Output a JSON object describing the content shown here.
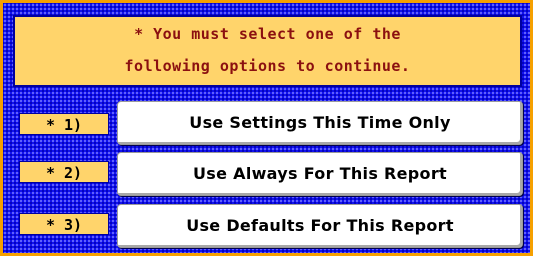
{
  "message": {
    "line1": "* You must select one of the",
    "line2": "following options to continue."
  },
  "options": [
    {
      "number": "* 1)",
      "label": "Use Settings This Time Only"
    },
    {
      "number": "* 2)",
      "label": "Use Always For This Report"
    },
    {
      "number": "* 3)",
      "label": "Use Defaults For This Report"
    }
  ],
  "colors": {
    "border": "#f5a000",
    "background": "#1212ee",
    "panel": "#ffd46b",
    "message_text": "#8b1010",
    "button": "#ffffff"
  }
}
